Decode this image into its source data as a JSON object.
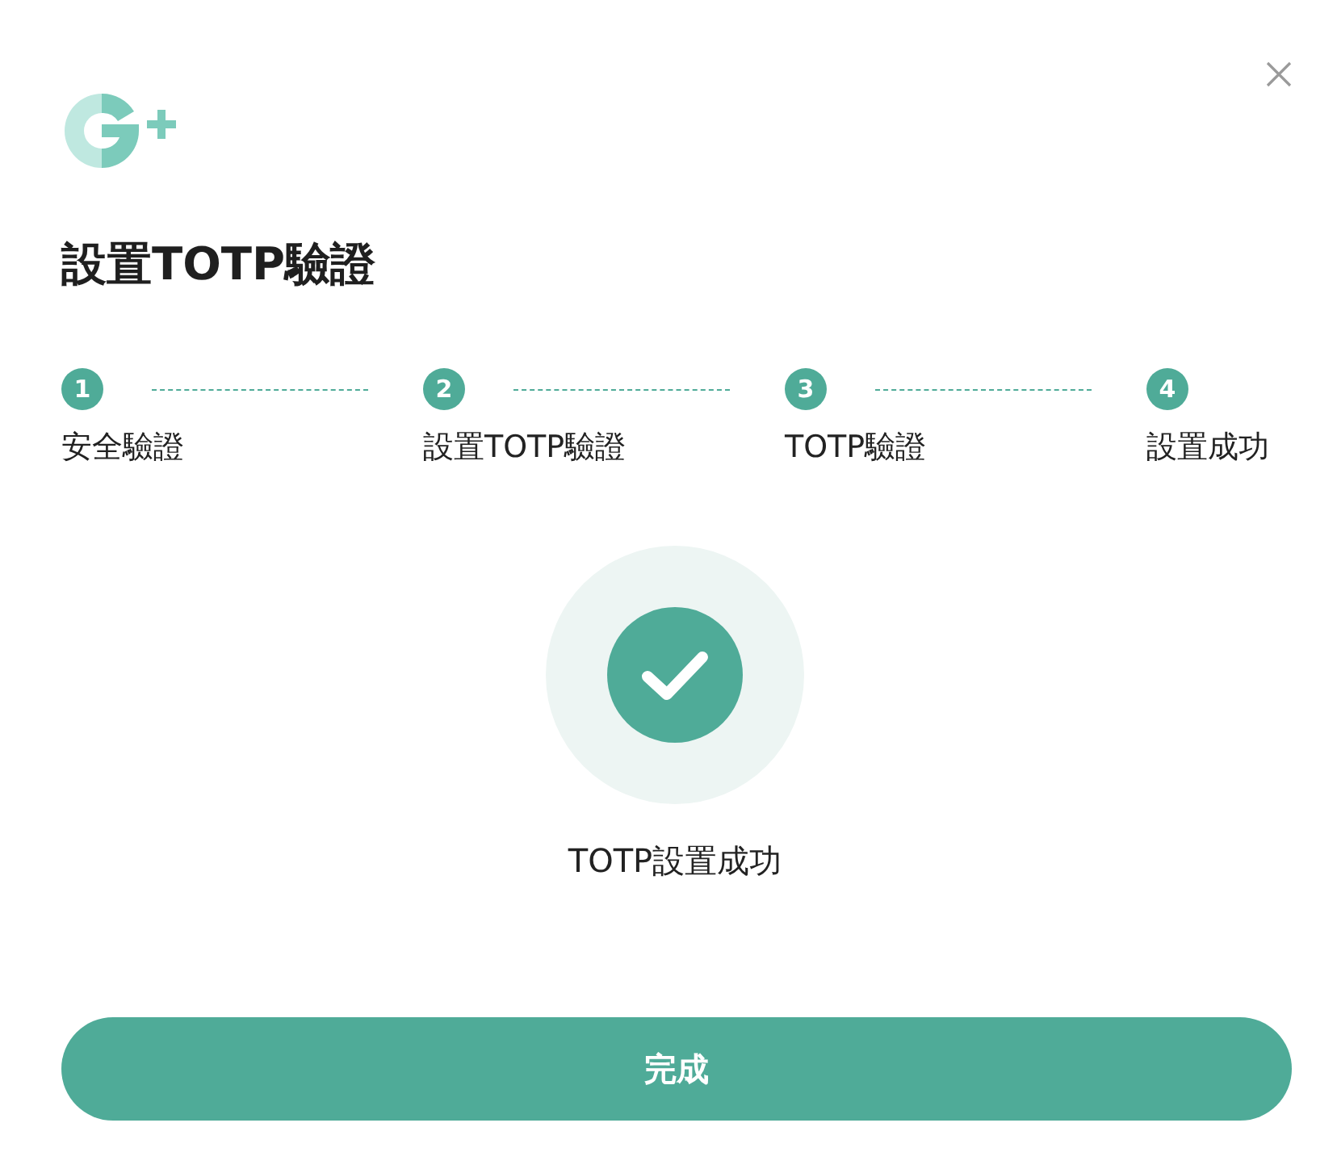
{
  "dialog": {
    "title": "設置TOTP驗證"
  },
  "steps": [
    {
      "number": "1",
      "label": "安全驗證",
      "done": true
    },
    {
      "number": "2",
      "label": "設置TOTP驗證",
      "done": true
    },
    {
      "number": "3",
      "label": "TOTP驗證",
      "done": true
    },
    {
      "number": "4",
      "label": "設置成功",
      "done": true
    }
  ],
  "result": {
    "message": "TOTP設置成功"
  },
  "button": {
    "label": "完成"
  }
}
